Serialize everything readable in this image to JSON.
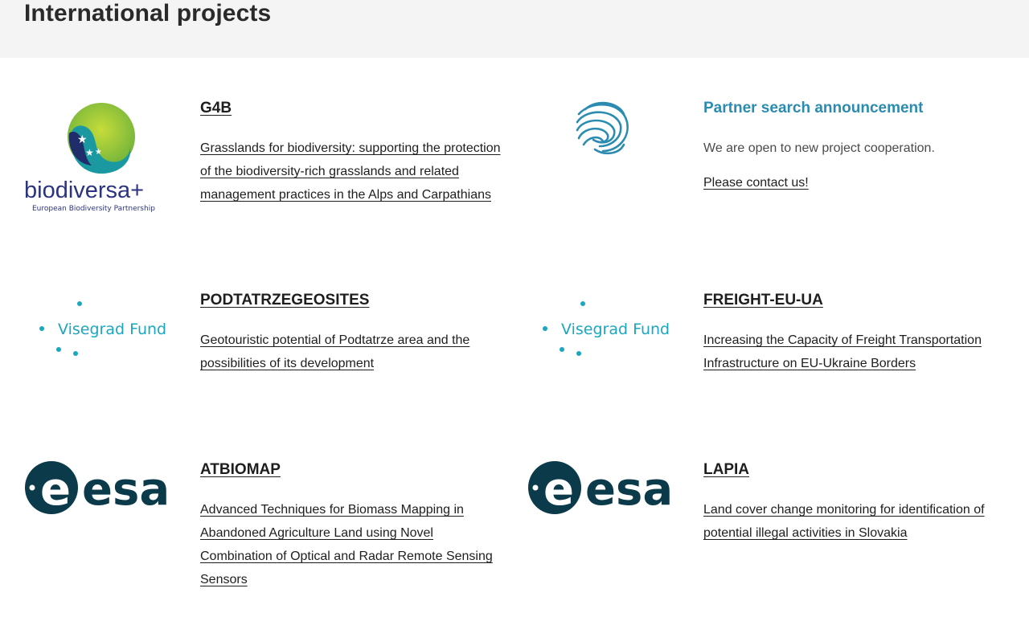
{
  "page": {
    "title": "International projects"
  },
  "projects": [
    {
      "logo": "biodiversa-logo",
      "logo_text": "biodiversa+",
      "logo_sub": "European Biodiversity Partnership",
      "title": "G4B",
      "description": "Grasslands for biodiversity: supporting the protection of the biodiversity-rich grasslands and related management practices in the Alps and Carpathians"
    },
    {
      "logo": "fingerprint-wave-logo",
      "title": "Partner search announcement",
      "description": "We are open to new project cooperation.",
      "link": "Please contact us!"
    },
    {
      "logo": "visegrad-fund-logo",
      "logo_text": "Visegrad Fund",
      "title": "PODTATRZEGEOSITES",
      "description": "Geotouristic potential of Podtatrze area and the possibilities of its development"
    },
    {
      "logo": "visegrad-fund-logo",
      "logo_text": "Visegrad Fund",
      "title": "FREIGHT-EU-UA",
      "description": "Increasing the Capacity of Freight Transportation Infrastructure on EU-Ukraine Borders"
    },
    {
      "logo": "esa-logo",
      "logo_text": "esa",
      "title": "ATBIOMAP",
      "description": "Advanced Techniques for Biomass Mapping in Abandoned Agriculture Land using Novel Combination of Optical and Radar Remote Sensing Sensors"
    },
    {
      "logo": "esa-logo",
      "logo_text": "esa",
      "title": "LAPIA",
      "description": "Land cover change monitoring for identification of potential illegal activities in Slovakia"
    }
  ],
  "colors": {
    "header_bg": "#f4f4f4",
    "accent_teal": "#2b8bb0",
    "visegrad_teal": "#1aa7bf",
    "esa_dark": "#0b3a4a",
    "biodiversa_blue": "#2b3480"
  }
}
